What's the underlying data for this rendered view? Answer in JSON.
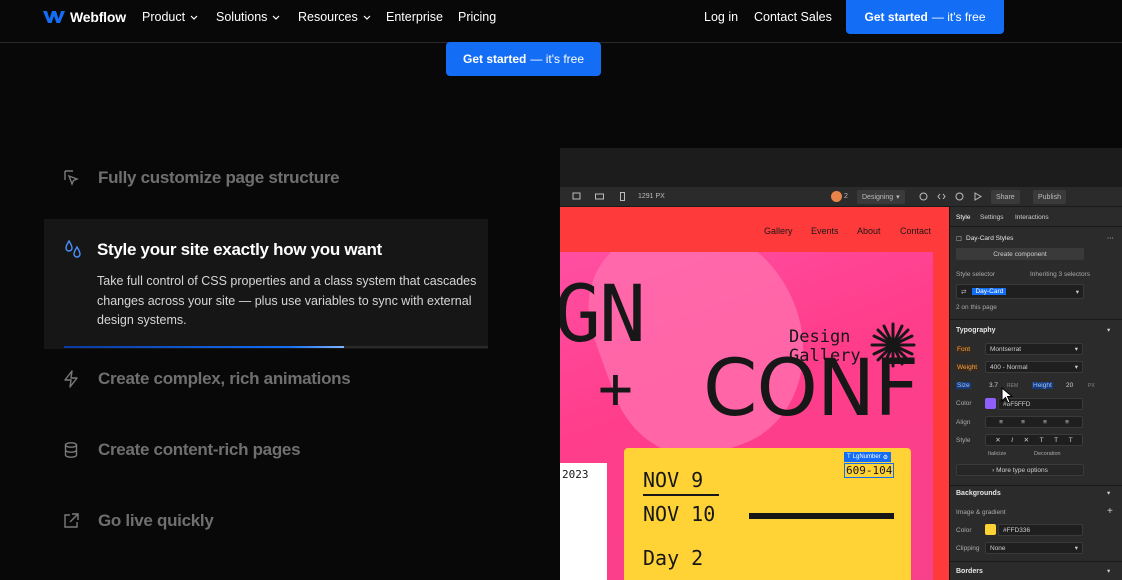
{
  "nav": {
    "brand": "Webflow",
    "items": [
      {
        "label": "Product",
        "has_dropdown": true
      },
      {
        "label": "Solutions",
        "has_dropdown": true
      },
      {
        "label": "Resources",
        "has_dropdown": true
      },
      {
        "label": "Enterprise",
        "has_dropdown": false
      },
      {
        "label": "Pricing",
        "has_dropdown": false
      }
    ],
    "login": "Log in",
    "contact": "Contact Sales",
    "cta_bold": "Get started",
    "cta_light": "— it's free"
  },
  "hero_cta": {
    "bold": "Get started",
    "light": "— it's free"
  },
  "features": {
    "items": [
      {
        "label": "Fully customize page structure",
        "icon": "cursor-select-icon"
      },
      {
        "label": "Create complex, rich animations",
        "icon": "lightning-icon"
      },
      {
        "label": "Create content-rich pages",
        "icon": "database-icon"
      },
      {
        "label": "Go live quickly",
        "icon": "external-link-icon"
      }
    ],
    "active": {
      "title": "Style your site exactly how you want",
      "description": "Take full control of CSS properties and a class system that cascades changes across your site — plus use variables to sync with external design systems.",
      "icon": "droplets-icon",
      "progress": 0.66
    }
  },
  "designer": {
    "toolbar": {
      "width": "1291 PX",
      "collaborators": "2",
      "mode": "Designing",
      "share": "Share",
      "publish": "Publish"
    },
    "canvas": {
      "nav": [
        "Gallery",
        "Events",
        "About",
        "Contact"
      ],
      "big_1": "GN",
      "big_2": "+",
      "big_3": "CONF",
      "brand_line1": "Design",
      "brand_line2": "Gallery.",
      "year": "2023",
      "date_1": "NOV 9",
      "date_2": "NOV 10",
      "day": "Day 2",
      "tag": "LgNumber",
      "number": "609-104"
    },
    "panel": {
      "tabs": [
        "Style",
        "Settings",
        "Interactions"
      ],
      "component": "Day-Card Styles",
      "create_component": "Create component",
      "style_selector": "Style selector",
      "inheriting": "Inheriting 3 selectors",
      "selector_value": "Day-Card",
      "on_page": "2 on this page",
      "typography": "Typography",
      "font_label": "Font",
      "font_value": "Montserrat",
      "weight_label": "Weight",
      "weight_value": "400 - Normal",
      "size_label": "Size",
      "size_value": "3.7",
      "size_unit": "REM",
      "height_label": "Height",
      "height_value": "20",
      "height_unit": "PX",
      "color_label": "Color",
      "color_value": "#8F5FFD",
      "align_label": "Align",
      "style_label": "Style",
      "italicize": "Italicize",
      "decoration": "Decoration",
      "more_type": "More type options",
      "backgrounds": "Backgrounds",
      "image_gradient": "Image & gradient",
      "bg_color_label": "Color",
      "bg_color_value": "#FFD336",
      "clipping_label": "Clipping",
      "clipping_value": "None",
      "borders": "Borders"
    }
  },
  "colors": {
    "accent": "#146ef5",
    "canvas_red": "#ff3a3a",
    "poster_pink": "#ff4fa3",
    "card_yellow": "#ffd336",
    "text_purple": "#8f5ffd"
  }
}
